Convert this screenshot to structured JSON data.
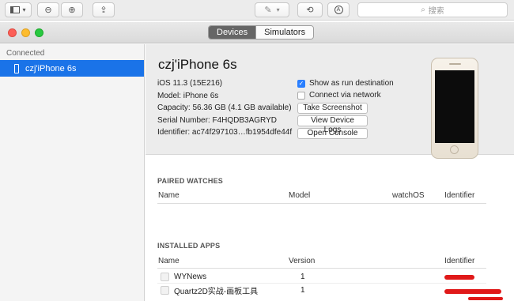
{
  "toolbar": {
    "search_placeholder": "搜索",
    "icons": [
      "sidebar-toggle-icon",
      "chevron-down-icon",
      "zoom-out-icon",
      "zoom-in-icon",
      "share-icon",
      "pen-icon",
      "rotate-icon",
      "annotate-icon",
      "search-icon"
    ]
  },
  "window": {
    "tabs": [
      {
        "label": "Devices",
        "selected": true
      },
      {
        "label": "Simulators",
        "selected": false
      }
    ]
  },
  "sidebar": {
    "section_title": "Connected",
    "items": [
      {
        "label": "czj'iPhone 6s",
        "selected": true
      }
    ]
  },
  "device": {
    "name": "czj'iPhone 6s",
    "ios": "iOS 11.3 (15E216)",
    "model": "Model: iPhone 6s",
    "capacity": "Capacity: 56.36 GB (4.1 GB available)",
    "serial": "Serial Number: F4HQDB3AGRYD",
    "identifier": "Identifier: ac74f297103…fb1954dfe44f",
    "show_run_destination": {
      "label": "Show as run destination",
      "checked": true
    },
    "connect_network": {
      "label": "Connect via network",
      "checked": false
    },
    "buttons": {
      "screenshot": "Take Screenshot",
      "logs": "View Device Logs",
      "console": "Open Console"
    }
  },
  "paired_watches": {
    "title": "PAIRED WATCHES",
    "columns": [
      "Name",
      "Model",
      "watchOS",
      "Identifier"
    ]
  },
  "installed_apps": {
    "title": "INSTALLED APPS",
    "columns": [
      "Name",
      "Version",
      "Identifier"
    ],
    "rows": [
      {
        "name": "WYNews",
        "version": "1"
      },
      {
        "name": "Quartz2D实战-画板工具",
        "version": "1"
      }
    ]
  },
  "colors": {
    "accent": "#1a73e8",
    "redaction": "#e01919"
  }
}
